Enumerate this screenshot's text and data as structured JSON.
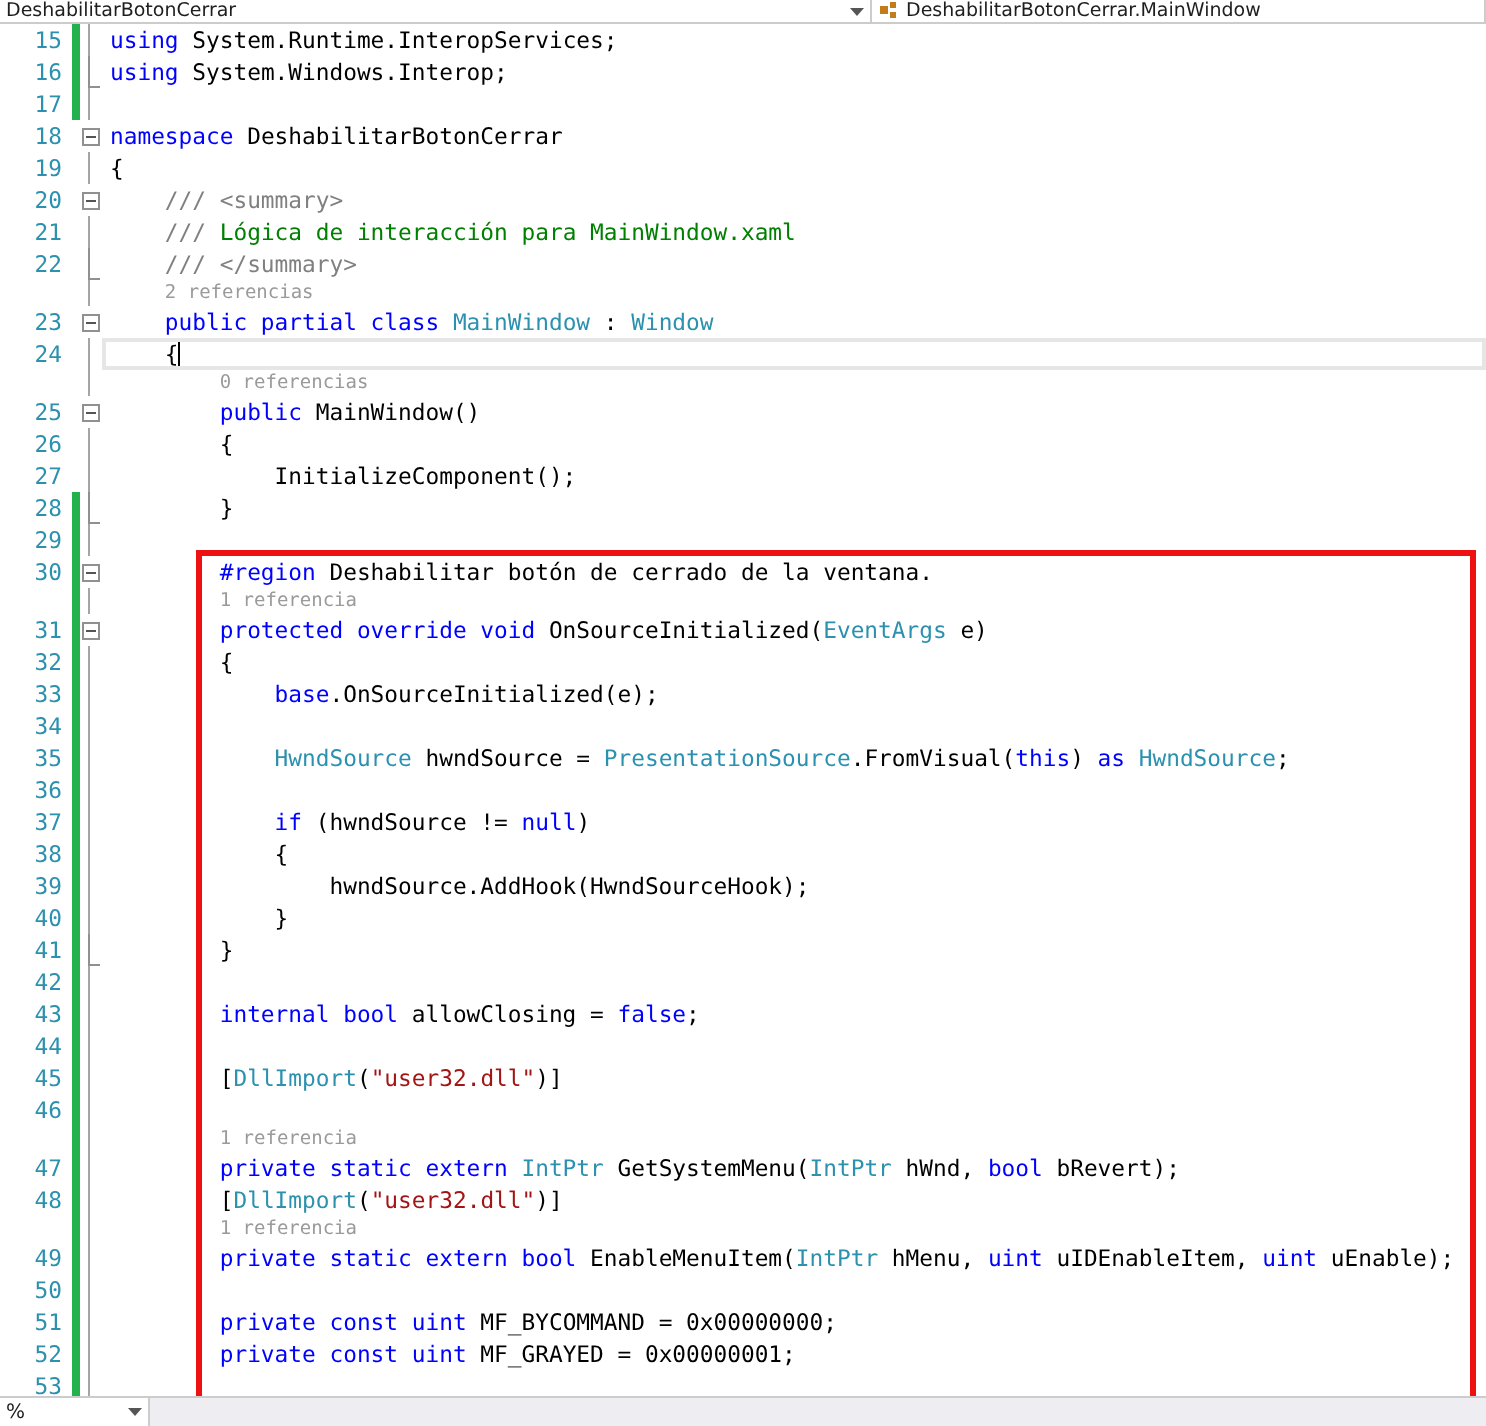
{
  "toolbar": {
    "project_dropdown": "DeshabilitarBotonCerrar",
    "member_dropdown": "DeshabilitarBotonCerrar.MainWindow"
  },
  "lines": [
    {
      "kind": "code",
      "number": "15",
      "modified": true,
      "collapsible": false,
      "fold_end": false,
      "highlighted": false,
      "tokens": [
        {
          "kind": "keyword",
          "text": "using"
        },
        {
          "kind": "plain",
          "text": " System.Runtime.InteropServices;"
        }
      ]
    },
    {
      "kind": "code",
      "number": "16",
      "modified": true,
      "collapsible": false,
      "fold_end": true,
      "highlighted": false,
      "tokens": [
        {
          "kind": "keyword",
          "text": "using"
        },
        {
          "kind": "plain",
          "text": " System.Windows.Interop;"
        }
      ]
    },
    {
      "kind": "code",
      "number": "17",
      "modified": true,
      "collapsible": false,
      "fold_end": false,
      "highlighted": false
    },
    {
      "kind": "code",
      "number": "18",
      "modified": false,
      "collapsible": true,
      "fold_end": false,
      "highlighted": false,
      "tokens": [
        {
          "kind": "keyword",
          "text": "namespace"
        },
        {
          "kind": "plain",
          "text": " DeshabilitarBotonCerrar"
        }
      ]
    },
    {
      "kind": "code",
      "number": "19",
      "modified": false,
      "collapsible": false,
      "fold_end": false,
      "highlighted": false,
      "tokens": [
        {
          "kind": "plain",
          "text": "{"
        }
      ]
    },
    {
      "kind": "code",
      "number": "20",
      "modified": false,
      "collapsible": true,
      "fold_end": false,
      "highlighted": false,
      "tokens": [
        {
          "kind": "doc",
          "text": "    /// <summary>"
        }
      ]
    },
    {
      "kind": "code",
      "number": "21",
      "modified": false,
      "collapsible": false,
      "fold_end": false,
      "highlighted": false,
      "tokens": [
        {
          "kind": "doc",
          "text": "    /// "
        },
        {
          "kind": "comment",
          "text": "Lógica de interacción para MainWindow.xaml"
        }
      ]
    },
    {
      "kind": "code",
      "number": "22",
      "modified": false,
      "collapsible": false,
      "fold_end": true,
      "highlighted": false,
      "tokens": [
        {
          "kind": "doc",
          "text": "    /// </summary>"
        }
      ]
    },
    {
      "kind": "lens",
      "highlighted": false,
      "text": "2 referencias"
    },
    {
      "kind": "code",
      "number": "23",
      "modified": false,
      "collapsible": true,
      "fold_end": false,
      "highlighted": false,
      "tokens": [
        {
          "kind": "keyword",
          "text": "    public partial class "
        },
        {
          "kind": "type",
          "text": "MainWindow"
        },
        {
          "kind": "plain",
          "text": " : "
        },
        {
          "kind": "type",
          "text": "Window"
        }
      ]
    },
    {
      "kind": "code",
      "number": "24",
      "modified": false,
      "collapsible": false,
      "fold_end": false,
      "highlighted": false,
      "current": true,
      "tokens": [
        {
          "kind": "plain",
          "text": "    {"
        }
      ]
    },
    {
      "kind": "lens",
      "highlighted": false,
      "text": "0 referencias"
    },
    {
      "kind": "code",
      "number": "25",
      "modified": false,
      "collapsible": true,
      "fold_end": false,
      "highlighted": false,
      "tokens": [
        {
          "kind": "keyword",
          "text": "        public"
        },
        {
          "kind": "plain",
          "text": " MainWindow()"
        }
      ]
    },
    {
      "kind": "code",
      "number": "26",
      "modified": false,
      "collapsible": false,
      "fold_end": false,
      "highlighted": false,
      "tokens": [
        {
          "kind": "plain",
          "text": "        {"
        }
      ]
    },
    {
      "kind": "code",
      "number": "27",
      "modified": false,
      "collapsible": false,
      "fold_end": false,
      "highlighted": false,
      "tokens": [
        {
          "kind": "plain",
          "text": "            InitializeComponent();"
        }
      ]
    },
    {
      "kind": "code",
      "number": "28",
      "modified": true,
      "collapsible": false,
      "fold_end": true,
      "highlighted": false,
      "tokens": [
        {
          "kind": "plain",
          "text": "        }"
        }
      ]
    },
    {
      "kind": "code",
      "number": "29",
      "modified": true,
      "collapsible": false,
      "fold_end": false,
      "highlighted": false
    },
    {
      "kind": "code",
      "number": "30",
      "modified": true,
      "collapsible": true,
      "fold_end": false,
      "highlighted": true,
      "tokens": [
        {
          "kind": "keyword",
          "text": "        #region"
        },
        {
          "kind": "plain",
          "text": " Deshabilitar botón de cerrado de la ventana."
        }
      ]
    },
    {
      "kind": "lens",
      "highlighted": true,
      "text": "1 referencia"
    },
    {
      "kind": "code",
      "number": "31",
      "modified": true,
      "collapsible": true,
      "fold_end": false,
      "highlighted": true,
      "tokens": [
        {
          "kind": "keyword",
          "text": "        protected override void"
        },
        {
          "kind": "plain",
          "text": " OnSourceInitialized("
        },
        {
          "kind": "type",
          "text": "EventArgs"
        },
        {
          "kind": "plain",
          "text": " e)"
        }
      ]
    },
    {
      "kind": "code",
      "number": "32",
      "modified": true,
      "collapsible": false,
      "fold_end": false,
      "highlighted": true,
      "tokens": [
        {
          "kind": "plain",
          "text": "        {"
        }
      ]
    },
    {
      "kind": "code",
      "number": "33",
      "modified": true,
      "collapsible": false,
      "fold_end": false,
      "highlighted": true,
      "tokens": [
        {
          "kind": "keyword",
          "text": "            base"
        },
        {
          "kind": "plain",
          "text": ".OnSourceInitialized(e);"
        }
      ]
    },
    {
      "kind": "code",
      "number": "34",
      "modified": true,
      "collapsible": false,
      "fold_end": false,
      "highlighted": true
    },
    {
      "kind": "code",
      "number": "35",
      "modified": true,
      "collapsible": false,
      "fold_end": false,
      "highlighted": true,
      "tokens": [
        {
          "kind": "type",
          "text": "            HwndSource"
        },
        {
          "kind": "plain",
          "text": " hwndSource = "
        },
        {
          "kind": "type",
          "text": "PresentationSource"
        },
        {
          "kind": "plain",
          "text": ".FromVisual("
        },
        {
          "kind": "keyword",
          "text": "this"
        },
        {
          "kind": "plain",
          "text": ") "
        },
        {
          "kind": "keyword",
          "text": "as "
        },
        {
          "kind": "type",
          "text": "HwndSource"
        },
        {
          "kind": "plain",
          "text": ";"
        }
      ]
    },
    {
      "kind": "code",
      "number": "36",
      "modified": true,
      "collapsible": false,
      "fold_end": false,
      "highlighted": true
    },
    {
      "kind": "code",
      "number": "37",
      "modified": true,
      "collapsible": false,
      "fold_end": false,
      "highlighted": true,
      "tokens": [
        {
          "kind": "keyword",
          "text": "            if"
        },
        {
          "kind": "plain",
          "text": " (hwndSource != "
        },
        {
          "kind": "keyword",
          "text": "null"
        },
        {
          "kind": "plain",
          "text": ")"
        }
      ]
    },
    {
      "kind": "code",
      "number": "38",
      "modified": true,
      "collapsible": false,
      "fold_end": false,
      "highlighted": true,
      "tokens": [
        {
          "kind": "plain",
          "text": "            {"
        }
      ]
    },
    {
      "kind": "code",
      "number": "39",
      "modified": true,
      "collapsible": false,
      "fold_end": false,
      "highlighted": true,
      "tokens": [
        {
          "kind": "plain",
          "text": "                hwndSource.AddHook(HwndSourceHook);"
        }
      ]
    },
    {
      "kind": "code",
      "number": "40",
      "modified": true,
      "collapsible": false,
      "fold_end": false,
      "highlighted": true,
      "tokens": [
        {
          "kind": "plain",
          "text": "            }"
        }
      ]
    },
    {
      "kind": "code",
      "number": "41",
      "modified": true,
      "collapsible": false,
      "fold_end": true,
      "highlighted": true,
      "tokens": [
        {
          "kind": "plain",
          "text": "        }"
        }
      ]
    },
    {
      "kind": "code",
      "number": "42",
      "modified": true,
      "collapsible": false,
      "fold_end": false,
      "highlighted": true
    },
    {
      "kind": "code",
      "number": "43",
      "modified": true,
      "collapsible": false,
      "fold_end": false,
      "highlighted": true,
      "tokens": [
        {
          "kind": "keyword",
          "text": "        internal bool"
        },
        {
          "kind": "plain",
          "text": " allowClosing = "
        },
        {
          "kind": "keyword",
          "text": "false"
        },
        {
          "kind": "plain",
          "text": ";"
        }
      ]
    },
    {
      "kind": "code",
      "number": "44",
      "modified": true,
      "collapsible": false,
      "fold_end": false,
      "highlighted": true
    },
    {
      "kind": "code",
      "number": "45",
      "modified": true,
      "collapsible": false,
      "fold_end": false,
      "highlighted": true,
      "tokens": [
        {
          "kind": "plain",
          "text": "        ["
        },
        {
          "kind": "type",
          "text": "DllImport"
        },
        {
          "kind": "plain",
          "text": "("
        },
        {
          "kind": "string",
          "text": "\"user32.dll\""
        },
        {
          "kind": "plain",
          "text": ")]"
        }
      ]
    },
    {
      "kind": "code",
      "number": "46",
      "modified": true,
      "collapsible": false,
      "fold_end": false,
      "highlighted": true
    },
    {
      "kind": "lens",
      "highlighted": true,
      "text": "1 referencia"
    },
    {
      "kind": "code",
      "number": "47",
      "modified": true,
      "collapsible": false,
      "fold_end": false,
      "highlighted": true,
      "tokens": [
        {
          "kind": "keyword",
          "text": "        private static extern "
        },
        {
          "kind": "type",
          "text": "IntPtr"
        },
        {
          "kind": "plain",
          "text": " GetSystemMenu("
        },
        {
          "kind": "type",
          "text": "IntPtr"
        },
        {
          "kind": "plain",
          "text": " hWnd, "
        },
        {
          "kind": "keyword",
          "text": "bool"
        },
        {
          "kind": "plain",
          "text": " bRevert);"
        }
      ]
    },
    {
      "kind": "code",
      "number": "48",
      "modified": true,
      "collapsible": false,
      "fold_end": false,
      "highlighted": true,
      "tokens": [
        {
          "kind": "plain",
          "text": "        ["
        },
        {
          "kind": "type",
          "text": "DllImport"
        },
        {
          "kind": "plain",
          "text": "("
        },
        {
          "kind": "string",
          "text": "\"user32.dll\""
        },
        {
          "kind": "plain",
          "text": ")]"
        }
      ]
    },
    {
      "kind": "lens",
      "highlighted": true,
      "text": "1 referencia"
    },
    {
      "kind": "code",
      "number": "49",
      "modified": true,
      "collapsible": false,
      "fold_end": false,
      "highlighted": true,
      "tokens": [
        {
          "kind": "keyword",
          "text": "        private static extern bool"
        },
        {
          "kind": "plain",
          "text": " EnableMenuItem("
        },
        {
          "kind": "type",
          "text": "IntPtr"
        },
        {
          "kind": "plain",
          "text": " hMenu, "
        },
        {
          "kind": "keyword",
          "text": "uint"
        },
        {
          "kind": "plain",
          "text": " uIDEnableItem, "
        },
        {
          "kind": "keyword",
          "text": "uint"
        },
        {
          "kind": "plain",
          "text": " uEnable);"
        }
      ]
    },
    {
      "kind": "code",
      "number": "50",
      "modified": true,
      "collapsible": false,
      "fold_end": false,
      "highlighted": true
    },
    {
      "kind": "code",
      "number": "51",
      "modified": true,
      "collapsible": false,
      "fold_end": false,
      "highlighted": true,
      "tokens": [
        {
          "kind": "keyword",
          "text": "        private const uint"
        },
        {
          "kind": "plain",
          "text": " MF_BYCOMMAND = 0x00000000;"
        }
      ]
    },
    {
      "kind": "code",
      "number": "52",
      "modified": true,
      "collapsible": false,
      "fold_end": false,
      "highlighted": true,
      "tokens": [
        {
          "kind": "keyword",
          "text": "        private const uint"
        },
        {
          "kind": "plain",
          "text": " MF_GRAYED = 0x00000001;"
        }
      ]
    },
    {
      "kind": "code",
      "number": "53",
      "modified": true,
      "collapsible": false,
      "fold_end": false,
      "highlighted": true
    }
  ],
  "status_bar": {
    "zoom": "%"
  }
}
